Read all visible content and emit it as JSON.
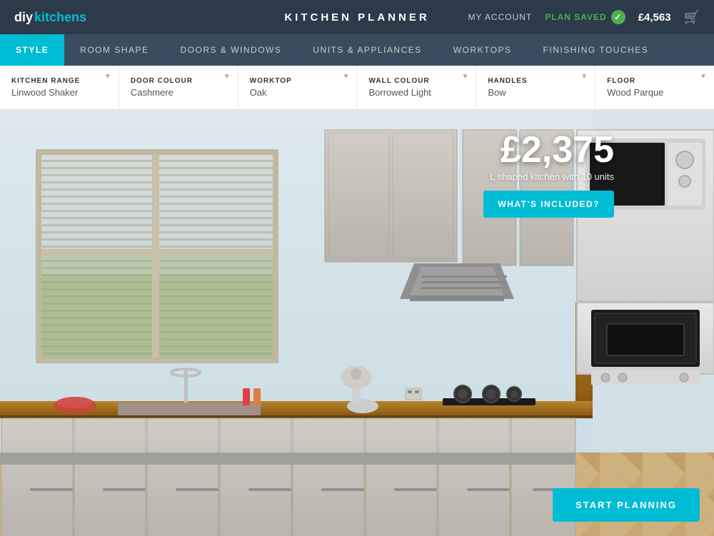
{
  "logo": {
    "diy": "diy",
    "kitchens": "kitchens"
  },
  "header": {
    "title": "KITCHEN PLANNER",
    "my_account": "MY ACCOUNT",
    "plan_saved": "PLAN SAVED",
    "price": "£4,563"
  },
  "nav": {
    "items": [
      {
        "label": "STYLE",
        "active": true
      },
      {
        "label": "ROOM SHAPE",
        "active": false
      },
      {
        "label": "DOORS & WINDOWS",
        "active": false
      },
      {
        "label": "UNITS & APPLIANCES",
        "active": false
      },
      {
        "label": "WORKTOPS",
        "active": false
      },
      {
        "label": "FINISHING TOUCHES",
        "active": false
      }
    ]
  },
  "style_bar": {
    "options": [
      {
        "label": "KITCHEN RANGE",
        "value": "Linwood Shaker"
      },
      {
        "label": "DOOR COLOUR",
        "value": "Cashmere"
      },
      {
        "label": "WORKTOP",
        "value": "Oak"
      },
      {
        "label": "WALL COLOUR",
        "value": "Borrowed Light"
      },
      {
        "label": "HANDLES",
        "value": "Bow"
      },
      {
        "label": "FLOOR",
        "value": "Wood Parque"
      }
    ]
  },
  "kitchen": {
    "price": "£2,375",
    "description": "L shaped kitchen with 10 units",
    "whats_included_label": "WHAT'S INCLUDED?",
    "start_planning_label": "START PLANNING"
  }
}
